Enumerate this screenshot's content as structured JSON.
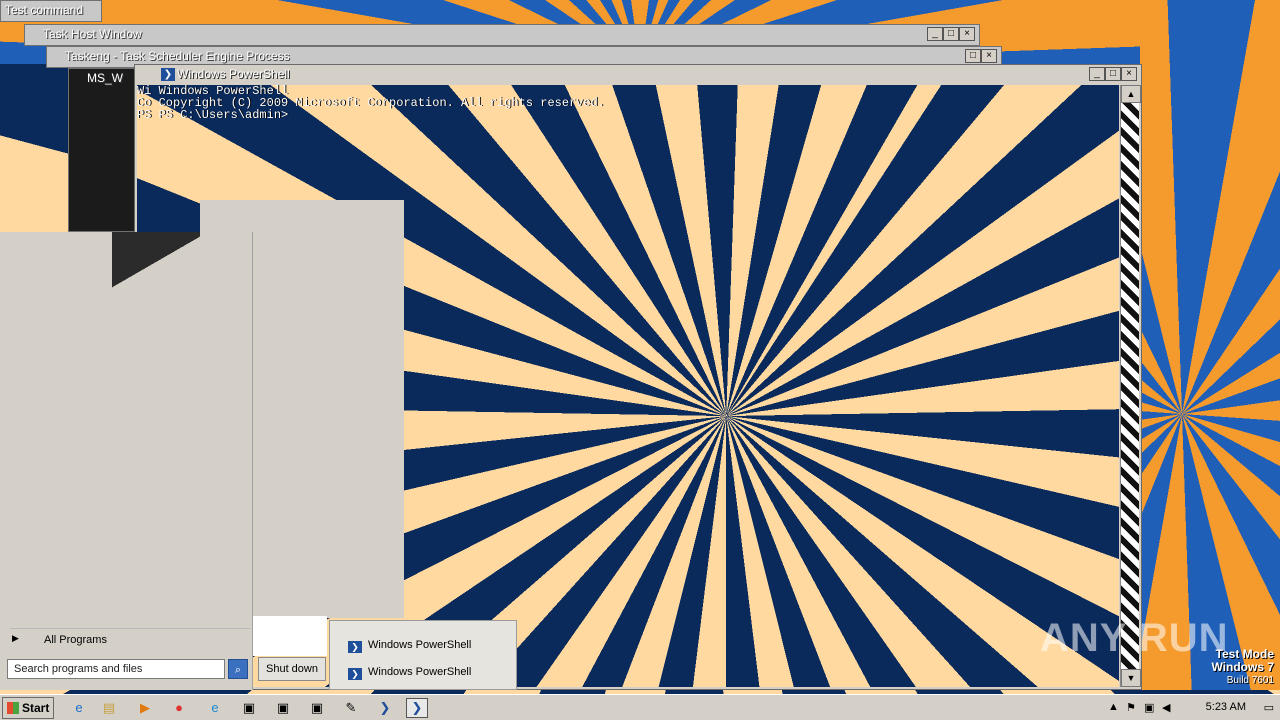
{
  "background_windows": {
    "cmd_title": "Test command",
    "taskhost_title": "Task Host Window",
    "taskeng_title": "Taskeng - Task Scheduler Engine Process",
    "ms_title": "MS_W"
  },
  "powershell": {
    "title": "Windows PowerShell",
    "icon_glyph": "❯",
    "lines": [
      "Wi Windows PowerShell",
      "Co Copyright (C) 2009 Microsoft Corporation. All rights reserved.",
      "",
      "PS PS C:\\Users\\admin>"
    ],
    "scroll_up": "▲",
    "scroll_down": "▼"
  },
  "start_menu": {
    "all_programs": "All Programs",
    "all_programs_arrow": "▶",
    "search_placeholder": "Search programs and files",
    "search_icon_glyph": "⌕",
    "shutdown": "Shut down"
  },
  "jump_list": {
    "items": [
      "Windows PowerShell",
      "Windows PowerShell"
    ]
  },
  "taskbar": {
    "start_label": "Start",
    "icons": [
      {
        "name": "ie-icon",
        "glyph": "e"
      },
      {
        "name": "explorer-icon",
        "glyph": "▤"
      },
      {
        "name": "media-player-icon",
        "glyph": "▶"
      },
      {
        "name": "chrome-icon",
        "glyph": "●"
      },
      {
        "name": "edge-icon",
        "glyph": "e"
      },
      {
        "name": "window-icon-1",
        "glyph": "▣"
      },
      {
        "name": "window-icon-2",
        "glyph": "▣"
      },
      {
        "name": "window-icon-3",
        "glyph": "▣"
      },
      {
        "name": "notepad-icon",
        "glyph": "✎"
      },
      {
        "name": "powershell-icon",
        "glyph": "❯"
      },
      {
        "name": "powershell-active-icon",
        "glyph": "❯"
      }
    ],
    "clock": "5:23 AM"
  },
  "watermark": "ANY RUN",
  "test_mode": {
    "line1": "Test Mode",
    "line2": "Windows 7",
    "line3": "Build 7601"
  },
  "colors": {
    "pattern_dark": "#0a2a5c",
    "pattern_light": "#ffd9a0",
    "desktop_orange": "#f59a2c",
    "desktop_blue": "#1f5fb8"
  }
}
